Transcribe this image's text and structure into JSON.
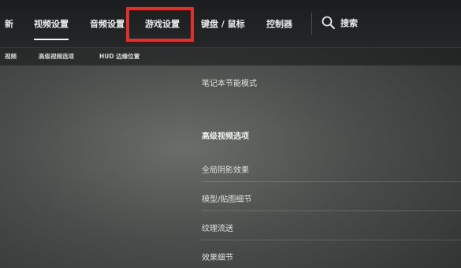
{
  "top_nav": {
    "tabs": [
      {
        "label": "新"
      },
      {
        "label": "视频设置",
        "active": true
      },
      {
        "label": "音频设置"
      },
      {
        "label": "游戏设置",
        "highlighted": true
      },
      {
        "label": "键盘 / 鼠标"
      },
      {
        "label": "控制器"
      }
    ],
    "search_label": "搜索",
    "search_icon": "search-icon",
    "highlight_color": "#e0302b"
  },
  "sub_nav": {
    "items": [
      {
        "label": "视频"
      },
      {
        "label": "高级视频选项"
      },
      {
        "label": "HUD 边缘位置"
      }
    ]
  },
  "settings": {
    "laptop_mode": "笔记本节能模式",
    "advanced_heading": "高级视频选项",
    "items": [
      {
        "label": "全局阴影效果"
      },
      {
        "label": "模型/贴图细节"
      },
      {
        "label": "纹理流送"
      },
      {
        "label": "效果细节"
      }
    ]
  }
}
